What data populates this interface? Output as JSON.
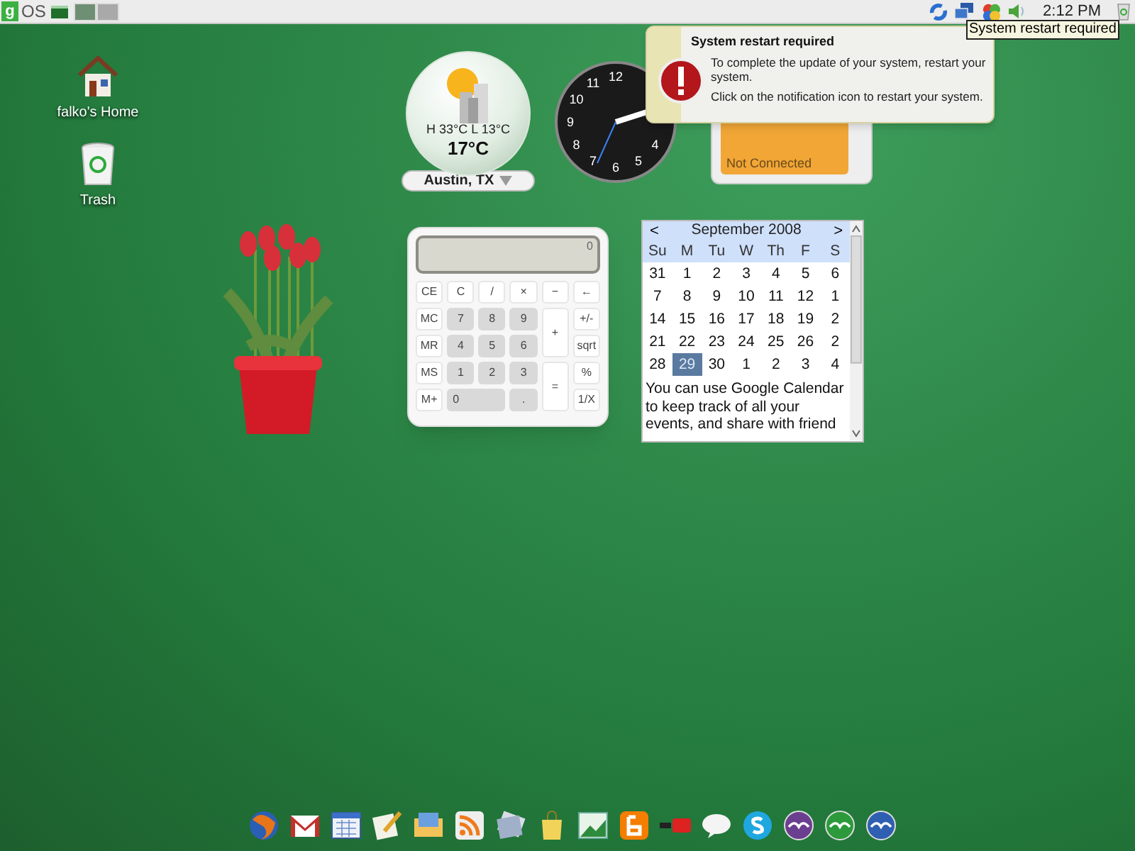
{
  "top_bar": {
    "logo_letter": "g",
    "os_label": "OS",
    "workspaces": [
      {
        "selected": true
      },
      {
        "selected": false
      }
    ],
    "clock": "2:12 PM",
    "tooltip": "System restart required"
  },
  "desktop_icons": [
    {
      "kind": "home",
      "label": "falko's Home"
    },
    {
      "kind": "trash",
      "label": "Trash"
    }
  ],
  "weather": {
    "high_low": "H 33°C L 13°C",
    "temperature": "17°C",
    "location": "Austin, TX"
  },
  "clock_widget": {
    "numerals": [
      "12",
      "11",
      "10",
      "9",
      "8",
      "4",
      "7",
      "5",
      "6"
    ]
  },
  "wifi_widget": {
    "status": "Not Connected"
  },
  "notification": {
    "title": "System restart required",
    "paragraphs": [
      "To complete the update of your system, restart your system.",
      "Click on the notification icon to restart your system."
    ]
  },
  "calculator": {
    "display": "0",
    "keys": [
      {
        "label": "CE",
        "kind": "function"
      },
      {
        "label": "C",
        "kind": "function"
      },
      {
        "label": "/",
        "kind": "function"
      },
      {
        "label": "×",
        "kind": "function"
      },
      {
        "label": "−",
        "kind": "function"
      },
      {
        "label": "←",
        "kind": "function"
      },
      {
        "label": "MC",
        "kind": "function"
      },
      {
        "label": "7",
        "kind": "digit"
      },
      {
        "label": "8",
        "kind": "digit"
      },
      {
        "label": "9",
        "kind": "digit"
      },
      {
        "label": "+",
        "kind": "tall"
      },
      {
        "label": "+/-",
        "kind": "function"
      },
      {
        "label": "MR",
        "kind": "function"
      },
      {
        "label": "4",
        "kind": "digit"
      },
      {
        "label": "5",
        "kind": "digit"
      },
      {
        "label": "6",
        "kind": "digit"
      },
      {
        "label": "sqrt",
        "kind": "function"
      },
      {
        "label": "MS",
        "kind": "function"
      },
      {
        "label": "1",
        "kind": "digit"
      },
      {
        "label": "2",
        "kind": "digit"
      },
      {
        "label": "3",
        "kind": "digit"
      },
      {
        "label": "=",
        "kind": "tall"
      },
      {
        "label": "%",
        "kind": "function"
      },
      {
        "label": "M+",
        "kind": "function"
      },
      {
        "label": "0",
        "kind": "wide"
      },
      {
        "label": ".",
        "kind": "digit"
      },
      {
        "label": "1/X",
        "kind": "function"
      }
    ]
  },
  "calendar": {
    "prev": "<",
    "month": "September 2008",
    "next": ">",
    "weekdays": [
      "Su",
      "M",
      "Tu",
      "W",
      "Th",
      "F",
      "S"
    ],
    "days": [
      {
        "label": "31",
        "selected": false
      },
      {
        "label": "1",
        "selected": false
      },
      {
        "label": "2",
        "selected": false
      },
      {
        "label": "3",
        "selected": false
      },
      {
        "label": "4",
        "selected": false
      },
      {
        "label": "5",
        "selected": false
      },
      {
        "label": "6",
        "selected": false
      },
      {
        "label": "7",
        "selected": false
      },
      {
        "label": "8",
        "selected": false
      },
      {
        "label": "9",
        "selected": false
      },
      {
        "label": "10",
        "selected": false
      },
      {
        "label": "11",
        "selected": false
      },
      {
        "label": "12",
        "selected": false
      },
      {
        "label": "1",
        "selected": false
      },
      {
        "label": "14",
        "selected": false
      },
      {
        "label": "15",
        "selected": false
      },
      {
        "label": "16",
        "selected": false
      },
      {
        "label": "17",
        "selected": false
      },
      {
        "label": "18",
        "selected": false
      },
      {
        "label": "19",
        "selected": false
      },
      {
        "label": "2",
        "selected": false
      },
      {
        "label": "21",
        "selected": false
      },
      {
        "label": "22",
        "selected": false
      },
      {
        "label": "23",
        "selected": false
      },
      {
        "label": "24",
        "selected": false
      },
      {
        "label": "25",
        "selected": false
      },
      {
        "label": "26",
        "selected": false
      },
      {
        "label": "2",
        "selected": false
      },
      {
        "label": "28",
        "selected": false
      },
      {
        "label": "29",
        "selected": true
      },
      {
        "label": "30",
        "selected": false
      },
      {
        "label": "1",
        "selected": false
      },
      {
        "label": "2",
        "selected": false
      },
      {
        "label": "3",
        "selected": false
      },
      {
        "label": "4",
        "selected": false
      }
    ],
    "note": "You can use Google Calendar to keep track of all your events, and share with friend"
  }
}
